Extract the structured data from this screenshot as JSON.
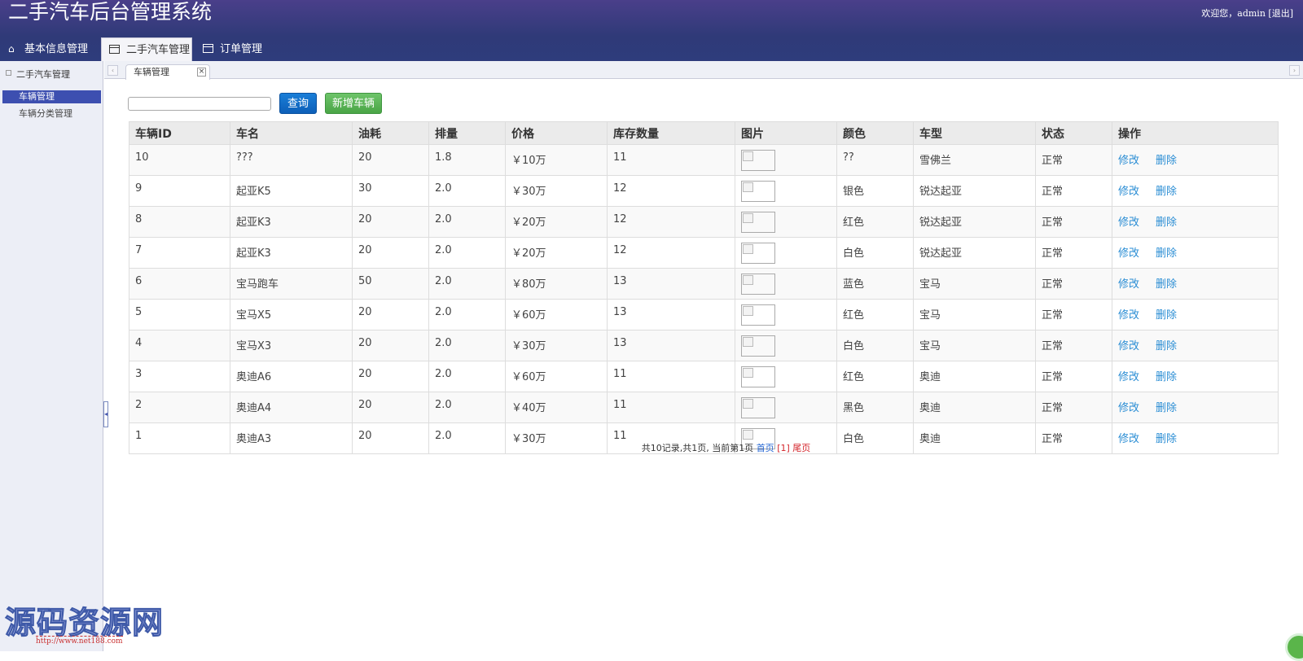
{
  "header": {
    "title": "二手汽车后台管理系统",
    "welcome": "欢迎您，admin [退出]"
  },
  "nav_tabs": [
    {
      "label": "基本信息管理",
      "icon": "home-icon"
    },
    {
      "label": "二手汽车管理",
      "icon": "table-icon",
      "active": true
    },
    {
      "label": "订单管理",
      "icon": "table-icon"
    }
  ],
  "sidebar": {
    "heading": "二手汽车管理",
    "items": [
      {
        "label": "车辆管理",
        "active": true
      },
      {
        "label": "车辆分类管理"
      }
    ]
  },
  "content_tab": {
    "label": "车辆管理",
    "close": "×"
  },
  "search": {
    "placeholder": "",
    "value": ""
  },
  "buttons": {
    "query": "查询",
    "add": "新增车辆"
  },
  "table": {
    "columns": [
      "车辆ID",
      "车名",
      "油耗",
      "排量",
      "价格",
      "库存数量",
      "图片",
      "颜色",
      "车型",
      "状态",
      "操作"
    ],
    "rows": [
      {
        "id": "10",
        "name": "???",
        "fuel": "20",
        "disp": "1.8",
        "price": "￥10万",
        "stock": "11",
        "color": "??",
        "model": "雪佛兰",
        "status": "正常"
      },
      {
        "id": "9",
        "name": "起亚K5",
        "fuel": "30",
        "disp": "2.0",
        "price": "￥30万",
        "stock": "12",
        "color": "银色",
        "model": "锐达起亚",
        "status": "正常"
      },
      {
        "id": "8",
        "name": "起亚K3",
        "fuel": "20",
        "disp": "2.0",
        "price": "￥20万",
        "stock": "12",
        "color": "红色",
        "model": "锐达起亚",
        "status": "正常"
      },
      {
        "id": "7",
        "name": "起亚K3",
        "fuel": "20",
        "disp": "2.0",
        "price": "￥20万",
        "stock": "12",
        "color": "白色",
        "model": "锐达起亚",
        "status": "正常"
      },
      {
        "id": "6",
        "name": "宝马跑车",
        "fuel": "50",
        "disp": "2.0",
        "price": "￥80万",
        "stock": "13",
        "color": "蓝色",
        "model": "宝马",
        "status": "正常"
      },
      {
        "id": "5",
        "name": "宝马X5",
        "fuel": "20",
        "disp": "2.0",
        "price": "￥60万",
        "stock": "13",
        "color": "红色",
        "model": "宝马",
        "status": "正常"
      },
      {
        "id": "4",
        "name": "宝马X3",
        "fuel": "20",
        "disp": "2.0",
        "price": "￥30万",
        "stock": "13",
        "color": "白色",
        "model": "宝马",
        "status": "正常"
      },
      {
        "id": "3",
        "name": "奥迪A6",
        "fuel": "20",
        "disp": "2.0",
        "price": "￥60万",
        "stock": "11",
        "color": "红色",
        "model": "奥迪",
        "status": "正常"
      },
      {
        "id": "2",
        "name": "奥迪A4",
        "fuel": "20",
        "disp": "2.0",
        "price": "￥40万",
        "stock": "11",
        "color": "黑色",
        "model": "奥迪",
        "status": "正常"
      },
      {
        "id": "1",
        "name": "奥迪A3",
        "fuel": "20",
        "disp": "2.0",
        "price": "￥30万",
        "stock": "11",
        "color": "白色",
        "model": "奥迪",
        "status": "正常"
      }
    ],
    "actions": {
      "edit": "修改",
      "delete": "删除"
    }
  },
  "pager": {
    "summary": "共10记录,共1页, 当前第1页",
    "first": "首页",
    "current": "[1]",
    "last": "尾页"
  },
  "watermark": {
    "text": "源码资源网",
    "url": "http://www.net188.com"
  },
  "colors": {
    "header": "#2f3a78",
    "sidebar_active": "#3d4fb0",
    "link": "#2a8dd4",
    "query_button": "#0d5fb8",
    "add_button": "#4aa546"
  }
}
